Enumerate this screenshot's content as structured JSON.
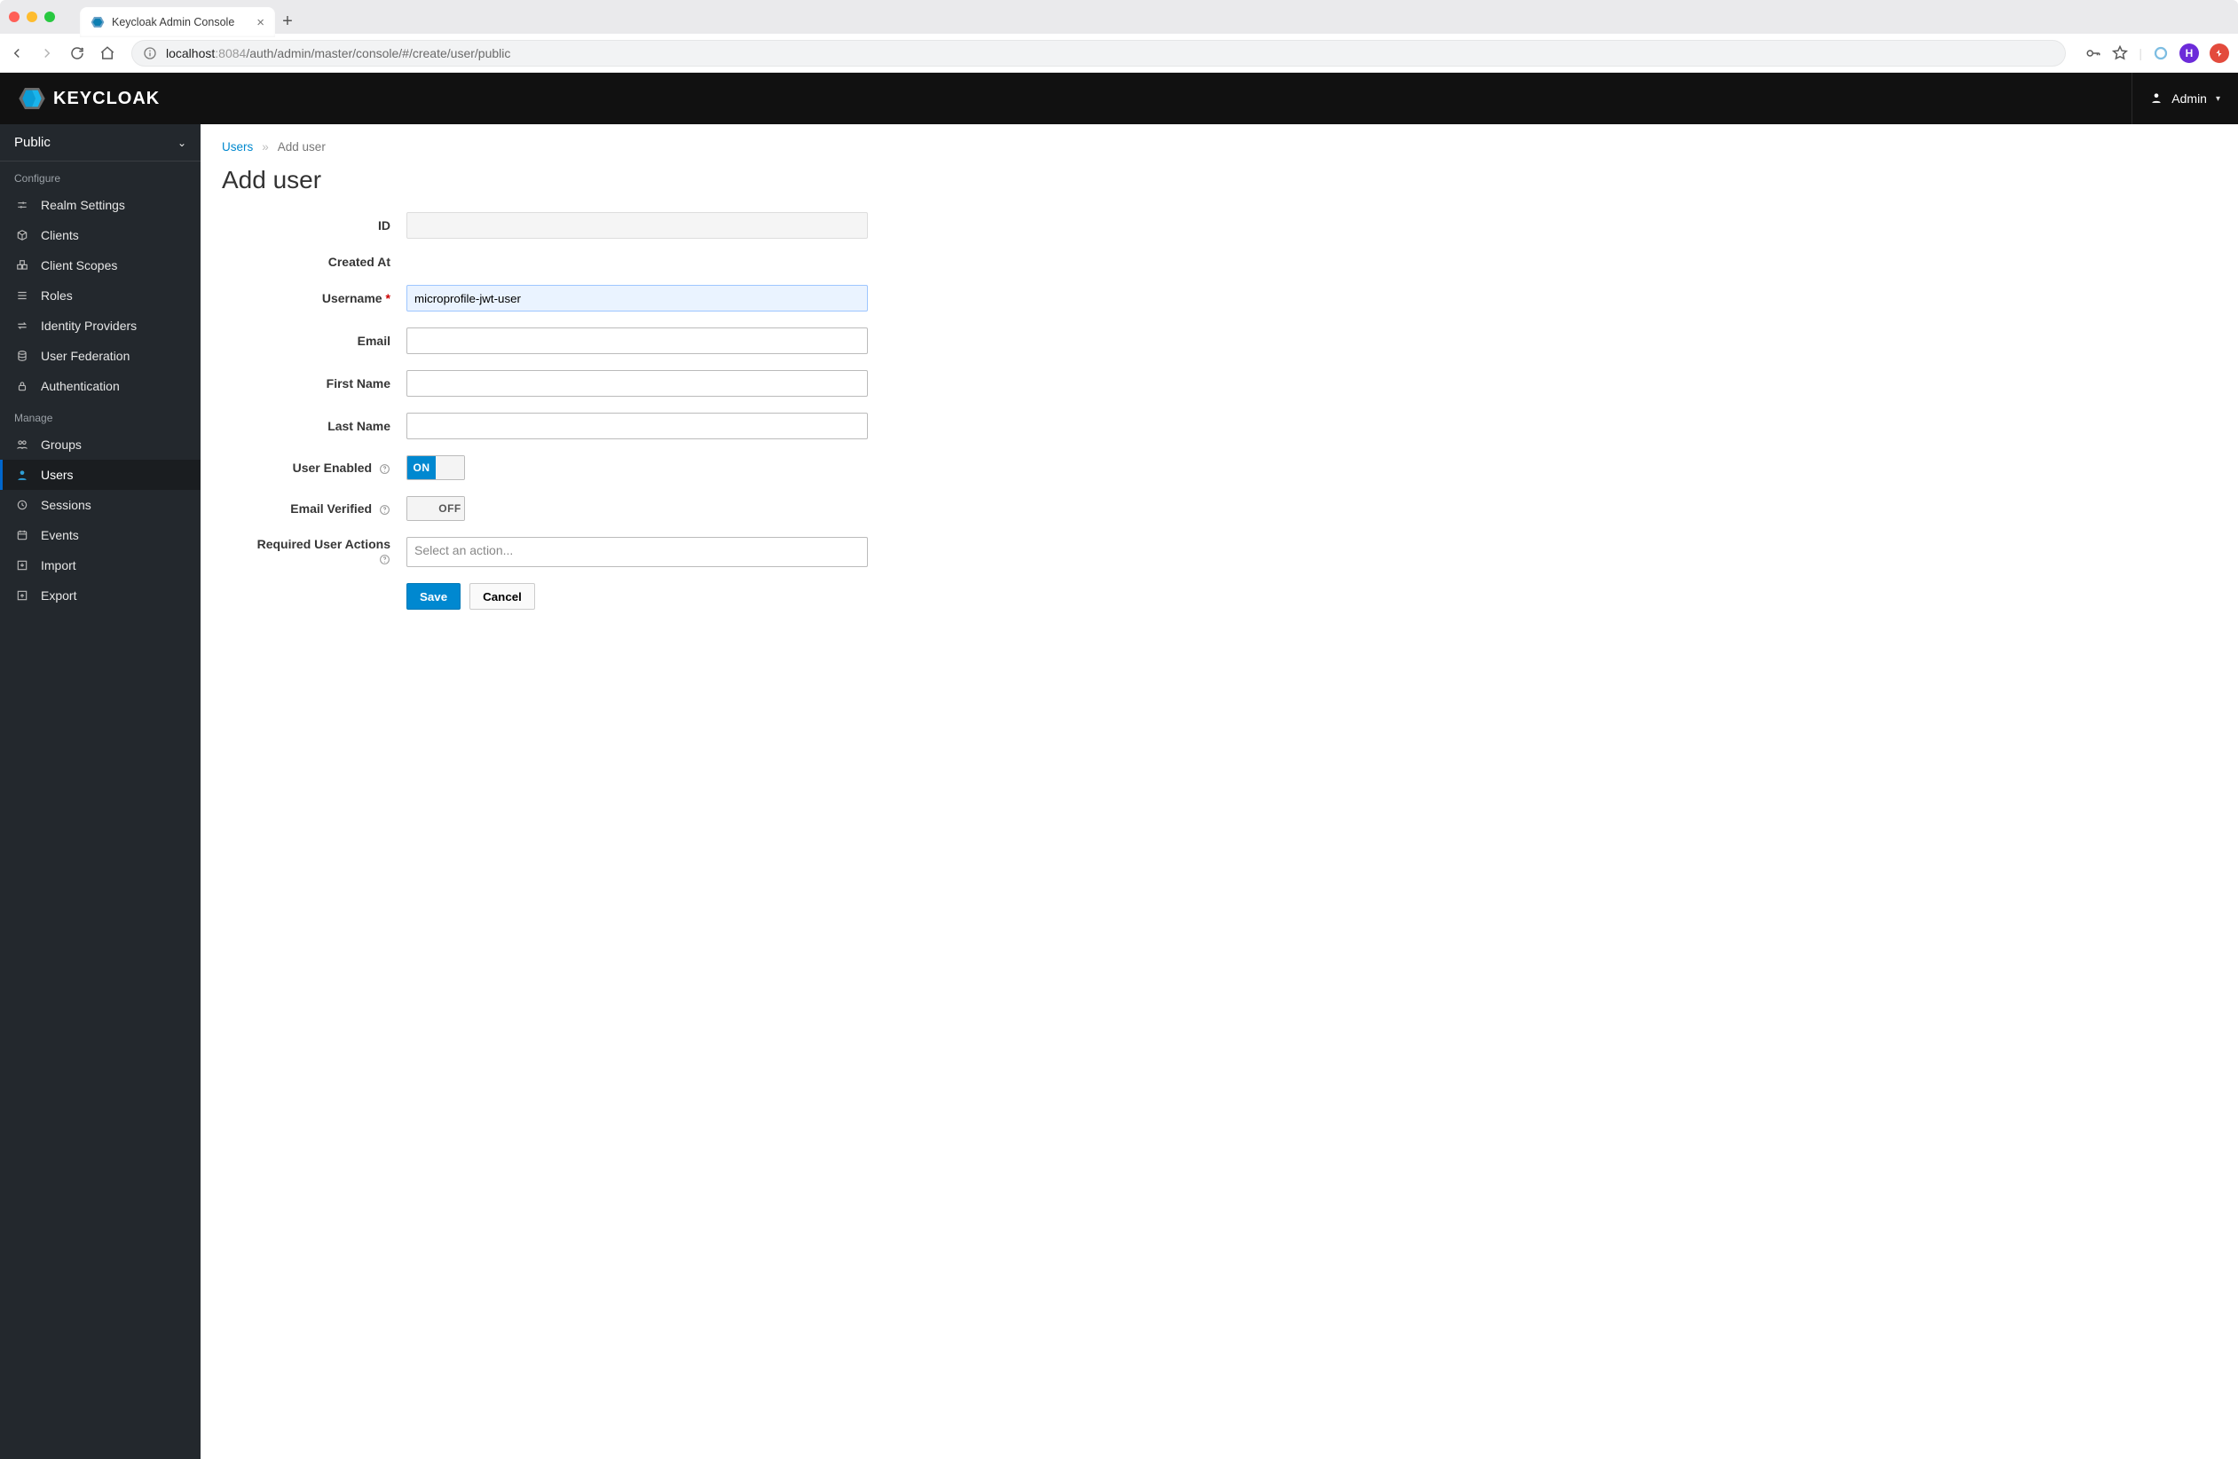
{
  "browser": {
    "tab_title": "Keycloak Admin Console",
    "address": {
      "host": "localhost",
      "port": ":8084",
      "path": "/auth/admin/master/console/#/create/user/public"
    },
    "avatar_initial": "H"
  },
  "header": {
    "logo_text": "KEYCLOAK",
    "user_label": "Admin"
  },
  "sidebar": {
    "realm_name": "Public",
    "configure_title": "Configure",
    "configure_items": {
      "realm_settings": "Realm Settings",
      "clients": "Clients",
      "client_scopes": "Client Scopes",
      "roles": "Roles",
      "identity_providers": "Identity Providers",
      "user_federation": "User Federation",
      "authentication": "Authentication"
    },
    "manage_title": "Manage",
    "manage_items": {
      "groups": "Groups",
      "users": "Users",
      "sessions": "Sessions",
      "events": "Events",
      "import": "Import",
      "export": "Export"
    }
  },
  "breadcrumb": {
    "users_link": "Users",
    "current": "Add user"
  },
  "page": {
    "title": "Add user"
  },
  "form": {
    "labels": {
      "id": "ID",
      "created_at": "Created At",
      "username": "Username",
      "email": "Email",
      "first_name": "First Name",
      "last_name": "Last Name",
      "user_enabled": "User Enabled",
      "email_verified": "Email Verified",
      "required_actions": "Required User Actions"
    },
    "values": {
      "id": "",
      "created_at": "",
      "username": "microprofile-jwt-user",
      "email": "",
      "first_name": "",
      "last_name": ""
    },
    "toggles": {
      "user_enabled_on": "ON",
      "user_enabled_off": "",
      "email_verified_on": "",
      "email_verified_off": "OFF"
    },
    "required_actions_placeholder": "Select an action..."
  },
  "buttons": {
    "save": "Save",
    "cancel": "Cancel"
  }
}
